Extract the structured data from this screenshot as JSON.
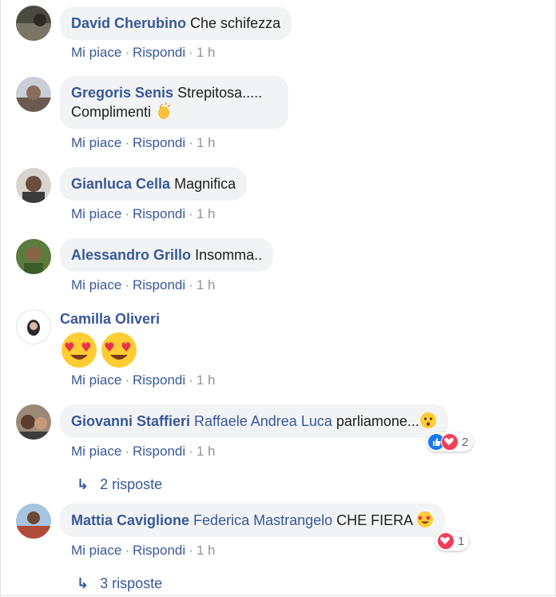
{
  "actions": {
    "like": "Mi piace",
    "reply": "Rispondi",
    "sep": "·",
    "time": "1 h"
  },
  "colors": {
    "link": "#385898",
    "bubble": "#f2f3f5",
    "meta": "#90949c"
  },
  "comments": [
    {
      "author": "David Cherubino",
      "text": "Che schifezza"
    },
    {
      "author": "Gregoris Senis",
      "text": "Strepitosa.....",
      "text2": "Complimenti",
      "emoji": "clapping-hands-icon"
    },
    {
      "author": "Gianluca Cella",
      "text": "Magnifica"
    },
    {
      "author": "Alessandro Grillo",
      "text": "Insomma.."
    },
    {
      "author": "Camilla Oliveri",
      "emoji": "heart-eyes-icon x2"
    },
    {
      "author": "Giovanni Staffieri",
      "mention": "Raffaele Andrea Luca",
      "text": "parliamone...",
      "emoji": "astonished-face-icon",
      "reactions": {
        "count": "2",
        "types": [
          "like",
          "love"
        ]
      },
      "replies": "2 risposte"
    },
    {
      "author": "Mattia Caviglione",
      "mention": "Federica Mastrangelo",
      "text": "CHE FIERA",
      "emoji": "heart-eyes-icon",
      "reactions": {
        "count": "1",
        "types": [
          "love"
        ]
      },
      "replies": "3 risposte"
    }
  ]
}
